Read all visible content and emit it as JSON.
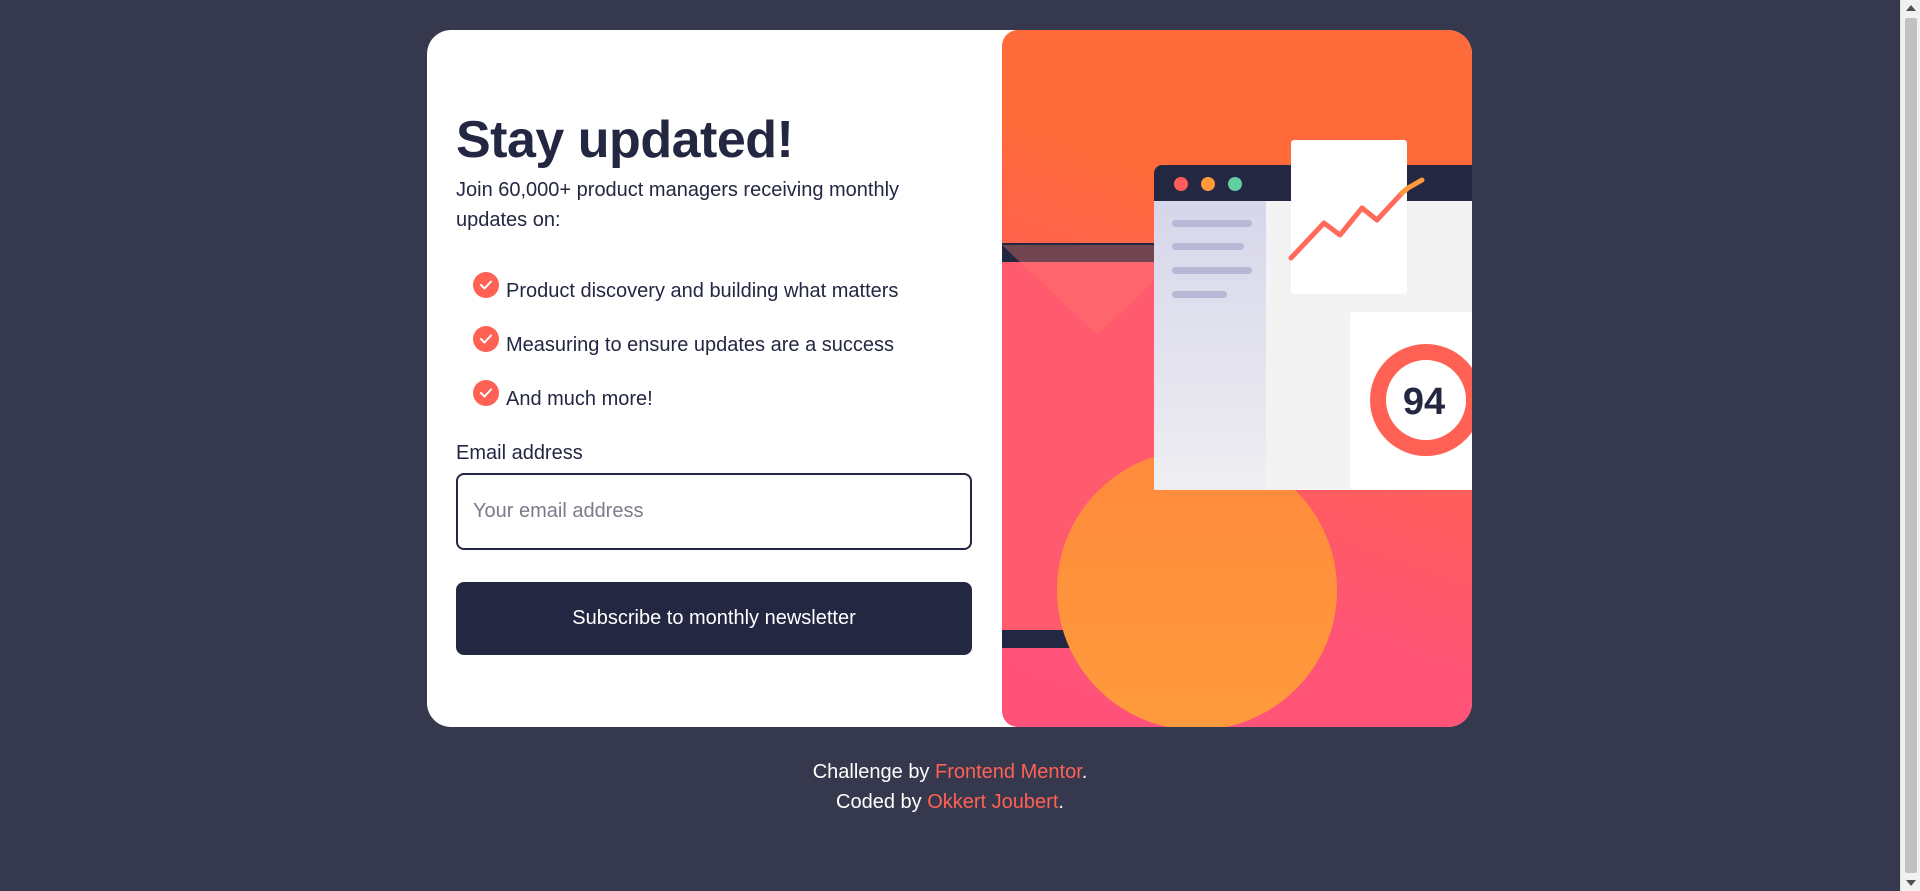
{
  "card": {
    "title": "Stay updated!",
    "intro": "Join 60,000+ product managers receiving monthly updates on:",
    "features": [
      "Product discovery and building what matters",
      "Measuring to ensure updates are a success",
      "And much more!"
    ],
    "email_label": "Email address",
    "email_placeholder": "Your email address",
    "email_value": "",
    "submit_label": "Subscribe to monthly newsletter"
  },
  "illustration": {
    "score": "94"
  },
  "footer": {
    "challenge_prefix": "Challenge by ",
    "challenge_link": "Frontend Mentor",
    "challenge_suffix": ".",
    "coded_prefix": "Coded by ",
    "coded_link": "Okkert Joubert",
    "coded_suffix": "."
  },
  "colors": {
    "background": "#36384d",
    "card": "#ffffff",
    "text": "#242742",
    "accent": "#ff6155",
    "button": "#242742"
  }
}
